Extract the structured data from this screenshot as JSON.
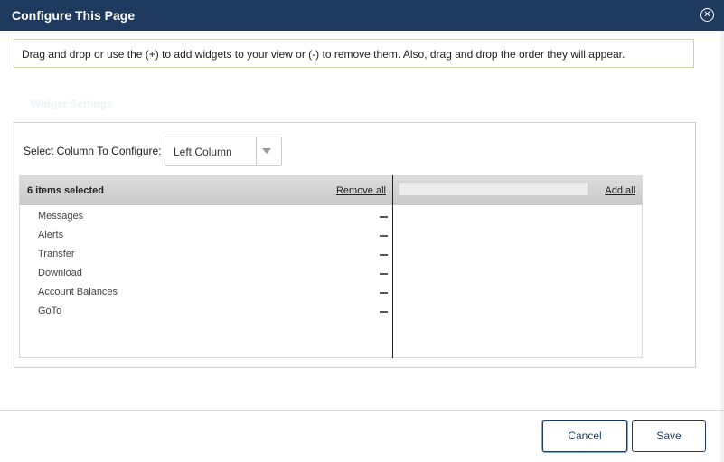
{
  "dialog": {
    "title": "Configure This Page",
    "close_icon": "close-circle-icon",
    "instructions": "Drag and drop or use the (+) to add widgets to your view or (-) to remove them. Also, drag and drop the order they will appear.",
    "widget_settings_heading": "Widget Settings"
  },
  "column_select": {
    "label": "Select Column To Configure:",
    "value": "Left Column",
    "icon": "chevron-down-icon"
  },
  "selected_panel": {
    "count_label": "6 items selected",
    "remove_all_label": "Remove all",
    "items": [
      {
        "label": "Messages"
      },
      {
        "label": "Alerts"
      },
      {
        "label": "Transfer"
      },
      {
        "label": "Download"
      },
      {
        "label": "Account Balances"
      },
      {
        "label": "GoTo"
      }
    ],
    "remove_icon": "minus-icon"
  },
  "available_panel": {
    "search_value": "",
    "add_all_label": "Add all"
  },
  "footer": {
    "cancel_label": "Cancel",
    "save_label": "Save"
  },
  "colors": {
    "titlebar": "#1f3a5f",
    "accent_border": "#1f3a5f"
  }
}
